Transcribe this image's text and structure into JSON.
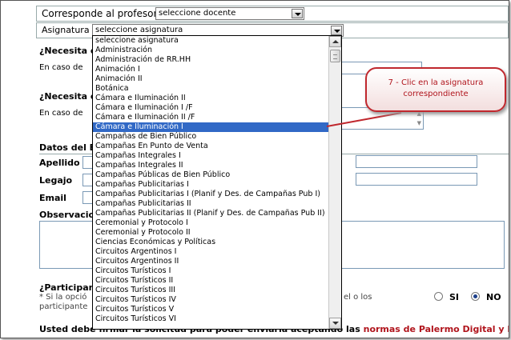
{
  "form": {
    "profesor_label": "Corresponde al profesor",
    "profesor_value": "seleccione docente",
    "asignatura_label": "Asignatura",
    "asignatura_value": "seleccione asignatura",
    "necesita_1": "¿Necesita e",
    "en_caso_1": "En caso de",
    "necesita_2": "¿Necesita c",
    "en_caso_2": "En caso de",
    "datos_label": "Datos del E",
    "apellido_label": "Apellido",
    "legajo_label": "Legajo",
    "email_label": "Email",
    "observaciones_label": "Observacio",
    "participan_label": "¿Participan",
    "si_la_opcion": "* Si la opció",
    "participante": "participante",
    "el_o_los": "el o los",
    "si_label": "SI",
    "no_label": "NO",
    "footer_text": "Usted debe firmar la solicitud para poder enviarla aceptando las",
    "footer_link": "normas de Palermo Digital y Palermo"
  },
  "dropdown": {
    "items": [
      "seleccione asignatura",
      "Administración",
      "Administración de RR.HH",
      "Animación I",
      "Animación II",
      "Botánica",
      "Cámara e Iluminación II",
      "Cámara e Iluminación I /F",
      "Cámara e Iluminación II /F",
      "Cámara e Iluminación I",
      "Campañas de Bien Público",
      "Campañas En Punto de Venta",
      "Campañas Integrales I",
      "Campañas Integrales II",
      "Campañas Públicas de Bien Público",
      "Campañas Publicitarias I",
      "Campañas Publicitarias I (Planif y Des. de Campañas Pub I)",
      "Campañas Publicitarias II",
      "Campañas Publicitarias II (Planif y Des. de Campañas Pub II)",
      "Ceremonial y Protocolo I",
      "Ceremonial y Protocolo II",
      "Ciencias Económicas y Políticas",
      "Circuitos Argentinos I",
      "Circuitos Argentinos II",
      "Circuitos Turísticos I",
      "Circuitos Turísticos II",
      "Circuitos Turísticos III",
      "Circuitos Turísticos IV",
      "Circuitos Turísticos V",
      "Circuitos Turísticos VI"
    ],
    "selected_index": 9
  },
  "callout": {
    "line1": "7 - Clic en la asignatura",
    "line2": "correspondiente"
  },
  "colors": {
    "selection": "#3169c6",
    "callout_border": "#c0282e",
    "callout_text": "#b0141c"
  }
}
